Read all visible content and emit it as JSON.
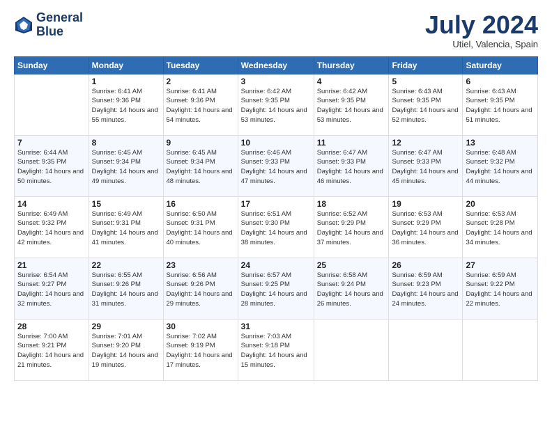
{
  "logo": {
    "line1": "General",
    "line2": "Blue"
  },
  "title": "July 2024",
  "location": "Utiel, Valencia, Spain",
  "days_header": [
    "Sunday",
    "Monday",
    "Tuesday",
    "Wednesday",
    "Thursday",
    "Friday",
    "Saturday"
  ],
  "weeks": [
    [
      {
        "day": "",
        "sunrise": "",
        "sunset": "",
        "daylight": ""
      },
      {
        "day": "1",
        "sunrise": "Sunrise: 6:41 AM",
        "sunset": "Sunset: 9:36 PM",
        "daylight": "Daylight: 14 hours and 55 minutes."
      },
      {
        "day": "2",
        "sunrise": "Sunrise: 6:41 AM",
        "sunset": "Sunset: 9:36 PM",
        "daylight": "Daylight: 14 hours and 54 minutes."
      },
      {
        "day": "3",
        "sunrise": "Sunrise: 6:42 AM",
        "sunset": "Sunset: 9:35 PM",
        "daylight": "Daylight: 14 hours and 53 minutes."
      },
      {
        "day": "4",
        "sunrise": "Sunrise: 6:42 AM",
        "sunset": "Sunset: 9:35 PM",
        "daylight": "Daylight: 14 hours and 53 minutes."
      },
      {
        "day": "5",
        "sunrise": "Sunrise: 6:43 AM",
        "sunset": "Sunset: 9:35 PM",
        "daylight": "Daylight: 14 hours and 52 minutes."
      },
      {
        "day": "6",
        "sunrise": "Sunrise: 6:43 AM",
        "sunset": "Sunset: 9:35 PM",
        "daylight": "Daylight: 14 hours and 51 minutes."
      }
    ],
    [
      {
        "day": "7",
        "sunrise": "Sunrise: 6:44 AM",
        "sunset": "Sunset: 9:35 PM",
        "daylight": "Daylight: 14 hours and 50 minutes."
      },
      {
        "day": "8",
        "sunrise": "Sunrise: 6:45 AM",
        "sunset": "Sunset: 9:34 PM",
        "daylight": "Daylight: 14 hours and 49 minutes."
      },
      {
        "day": "9",
        "sunrise": "Sunrise: 6:45 AM",
        "sunset": "Sunset: 9:34 PM",
        "daylight": "Daylight: 14 hours and 48 minutes."
      },
      {
        "day": "10",
        "sunrise": "Sunrise: 6:46 AM",
        "sunset": "Sunset: 9:33 PM",
        "daylight": "Daylight: 14 hours and 47 minutes."
      },
      {
        "day": "11",
        "sunrise": "Sunrise: 6:47 AM",
        "sunset": "Sunset: 9:33 PM",
        "daylight": "Daylight: 14 hours and 46 minutes."
      },
      {
        "day": "12",
        "sunrise": "Sunrise: 6:47 AM",
        "sunset": "Sunset: 9:33 PM",
        "daylight": "Daylight: 14 hours and 45 minutes."
      },
      {
        "day": "13",
        "sunrise": "Sunrise: 6:48 AM",
        "sunset": "Sunset: 9:32 PM",
        "daylight": "Daylight: 14 hours and 44 minutes."
      }
    ],
    [
      {
        "day": "14",
        "sunrise": "Sunrise: 6:49 AM",
        "sunset": "Sunset: 9:32 PM",
        "daylight": "Daylight: 14 hours and 42 minutes."
      },
      {
        "day": "15",
        "sunrise": "Sunrise: 6:49 AM",
        "sunset": "Sunset: 9:31 PM",
        "daylight": "Daylight: 14 hours and 41 minutes."
      },
      {
        "day": "16",
        "sunrise": "Sunrise: 6:50 AM",
        "sunset": "Sunset: 9:31 PM",
        "daylight": "Daylight: 14 hours and 40 minutes."
      },
      {
        "day": "17",
        "sunrise": "Sunrise: 6:51 AM",
        "sunset": "Sunset: 9:30 PM",
        "daylight": "Daylight: 14 hours and 38 minutes."
      },
      {
        "day": "18",
        "sunrise": "Sunrise: 6:52 AM",
        "sunset": "Sunset: 9:29 PM",
        "daylight": "Daylight: 14 hours and 37 minutes."
      },
      {
        "day": "19",
        "sunrise": "Sunrise: 6:53 AM",
        "sunset": "Sunset: 9:29 PM",
        "daylight": "Daylight: 14 hours and 36 minutes."
      },
      {
        "day": "20",
        "sunrise": "Sunrise: 6:53 AM",
        "sunset": "Sunset: 9:28 PM",
        "daylight": "Daylight: 14 hours and 34 minutes."
      }
    ],
    [
      {
        "day": "21",
        "sunrise": "Sunrise: 6:54 AM",
        "sunset": "Sunset: 9:27 PM",
        "daylight": "Daylight: 14 hours and 32 minutes."
      },
      {
        "day": "22",
        "sunrise": "Sunrise: 6:55 AM",
        "sunset": "Sunset: 9:26 PM",
        "daylight": "Daylight: 14 hours and 31 minutes."
      },
      {
        "day": "23",
        "sunrise": "Sunrise: 6:56 AM",
        "sunset": "Sunset: 9:26 PM",
        "daylight": "Daylight: 14 hours and 29 minutes."
      },
      {
        "day": "24",
        "sunrise": "Sunrise: 6:57 AM",
        "sunset": "Sunset: 9:25 PM",
        "daylight": "Daylight: 14 hours and 28 minutes."
      },
      {
        "day": "25",
        "sunrise": "Sunrise: 6:58 AM",
        "sunset": "Sunset: 9:24 PM",
        "daylight": "Daylight: 14 hours and 26 minutes."
      },
      {
        "day": "26",
        "sunrise": "Sunrise: 6:59 AM",
        "sunset": "Sunset: 9:23 PM",
        "daylight": "Daylight: 14 hours and 24 minutes."
      },
      {
        "day": "27",
        "sunrise": "Sunrise: 6:59 AM",
        "sunset": "Sunset: 9:22 PM",
        "daylight": "Daylight: 14 hours and 22 minutes."
      }
    ],
    [
      {
        "day": "28",
        "sunrise": "Sunrise: 7:00 AM",
        "sunset": "Sunset: 9:21 PM",
        "daylight": "Daylight: 14 hours and 21 minutes."
      },
      {
        "day": "29",
        "sunrise": "Sunrise: 7:01 AM",
        "sunset": "Sunset: 9:20 PM",
        "daylight": "Daylight: 14 hours and 19 minutes."
      },
      {
        "day": "30",
        "sunrise": "Sunrise: 7:02 AM",
        "sunset": "Sunset: 9:19 PM",
        "daylight": "Daylight: 14 hours and 17 minutes."
      },
      {
        "day": "31",
        "sunrise": "Sunrise: 7:03 AM",
        "sunset": "Sunset: 9:18 PM",
        "daylight": "Daylight: 14 hours and 15 minutes."
      },
      {
        "day": "",
        "sunrise": "",
        "sunset": "",
        "daylight": ""
      },
      {
        "day": "",
        "sunrise": "",
        "sunset": "",
        "daylight": ""
      },
      {
        "day": "",
        "sunrise": "",
        "sunset": "",
        "daylight": ""
      }
    ]
  ]
}
